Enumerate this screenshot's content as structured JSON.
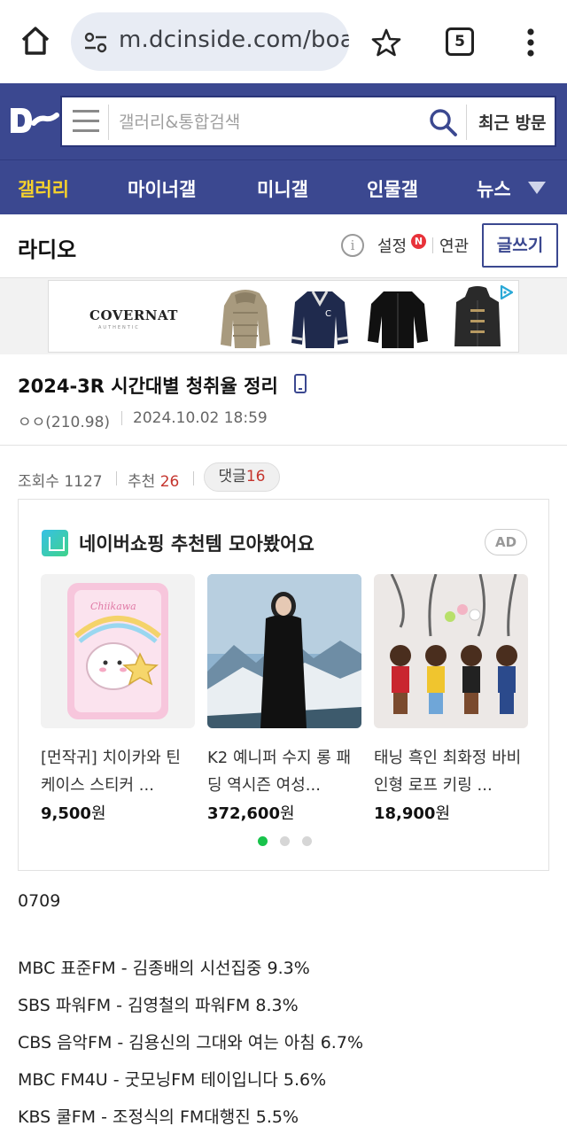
{
  "browser": {
    "url": "m.dcinside.com/boar",
    "tab_count": "5"
  },
  "header": {
    "search_placeholder": "갤러리&통합검색",
    "recent_visits": "최근 방문"
  },
  "nav": {
    "items": [
      {
        "label": "갤러리",
        "active": true
      },
      {
        "label": "마이너갤",
        "active": false
      },
      {
        "label": "미니갤",
        "active": false
      },
      {
        "label": "인물갤",
        "active": false
      },
      {
        "label": "뉴스",
        "active": false
      }
    ]
  },
  "gallery_bar": {
    "name": "라디오",
    "info": "i",
    "settings": "설정",
    "new_badge": "N",
    "related": "연관",
    "write": "글쓰기"
  },
  "banner": {
    "brand": "COVERNAT",
    "brand_sub": "AUTHENTIC"
  },
  "post": {
    "title": "2024-3R 시간대별 청취율 정리",
    "author": "ㅇㅇ(210.98)",
    "date": "2024.10.02 18:59",
    "views_label": "조회수",
    "views": "1127",
    "recommend_label": "추천",
    "recommend": "26",
    "comments_label": "댓글",
    "comments": "16"
  },
  "ad_card": {
    "title": "네이버쇼핑 추천템 모아봤어요",
    "badge": "AD",
    "products": [
      {
        "name": "[먼작귀] 치이카와 틴케이스 스티커 ...",
        "price": "9,500",
        "unit": "원"
      },
      {
        "name": "K2 예니퍼 수지 롱 패딩 역시즌 여성...",
        "price": "372,600",
        "unit": "원"
      },
      {
        "name": "태닝 흑인 최화정 바비 인형 로프 키링 ...",
        "price": "18,900",
        "unit": "원"
      }
    ],
    "page_dots": 3,
    "active_dot": 0
  },
  "body": {
    "lines": [
      "0709",
      "",
      "MBC 표준FM - 김종배의 시선집중 9.3%",
      "SBS 파워FM - 김영철의 파워FM 8.3%",
      "CBS 음악FM - 김용신의 그대와 여는 아침 6.7%",
      "MBC FM4U - 굿모닝FM 테이입니다 5.6%",
      "KBS 쿨FM - 조정식의 FM대행진 5.5%"
    ]
  },
  "colors": {
    "brand_blue": "#3b4890",
    "nav_active": "#f6d22c",
    "accent_red": "#c5352e",
    "dot_active": "#18c34b"
  }
}
